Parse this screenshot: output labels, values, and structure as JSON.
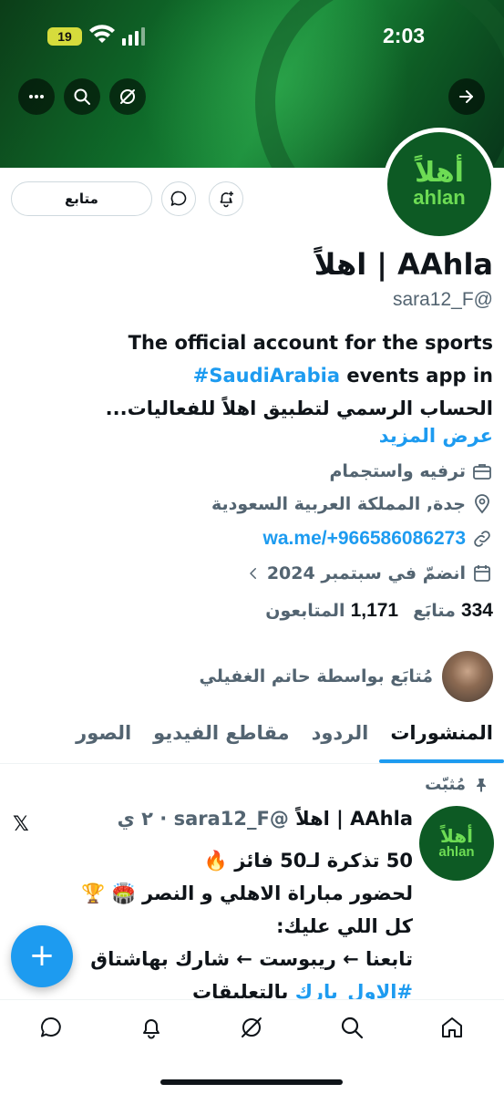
{
  "status_bar": {
    "time": "2:03",
    "battery": "19"
  },
  "colors": {
    "accent": "#1d9bf0",
    "banner": "#0f6b2a",
    "brand_green": "#6ddc54"
  },
  "header_buttons": [
    "more-icon",
    "search-icon",
    "grok-icon",
    "forward-arrow-icon"
  ],
  "avatar": {
    "glyph": "أهلاً",
    "word": "ahlan"
  },
  "actions": {
    "follow_label": "متابع"
  },
  "profile": {
    "display_name": "AAhla | اهلاً",
    "handle": "@sara12_F",
    "bio_line1": "The official account for the sports",
    "bio_hashtag": "#SaudiArabia",
    "bio_line2_rest": " events app in",
    "bio_line3": "الحساب الرسمي لتطبيق اهلاً للفعاليات...",
    "see_more": "عرض المزيد",
    "category": "ترفيه واستجمام",
    "location": "جدة, المملكة العربية السعودية",
    "link": "wa.me/+966586086273",
    "joined": "انضمّ في سبتمبر 2024"
  },
  "counts": {
    "following_count": "334",
    "following_label": "متابَع",
    "followers_count": "1,171",
    "followers_label": "المتابعون"
  },
  "followed_by": "مُتابَع بواسطة حاتم الغفيلي",
  "tabs": [
    "المنشورات",
    "الردود",
    "مقاطع الفيديو",
    "الصور"
  ],
  "pinned_post": {
    "pinned_label": "مُثبّت",
    "author": "AAhla | اهلاً",
    "handle": "@sara12_F",
    "time": "٢ ي",
    "line1": "50 تذكرة لـ50 فائز 🔥",
    "line2": "لحضور مباراة الاهلي و النصر 🏟️ 🏆",
    "line3": "كل اللي عليك:",
    "line4": "تابعنا ← ريبوست ← شارك بهاشتاق",
    "line5_tag": "#الاول_بارك",
    "line5_rest": " بالتعليقات"
  },
  "fab": {
    "label": "+"
  },
  "bottom_nav": [
    "messages-icon",
    "notifications-icon",
    "grok-icon",
    "search-icon",
    "home-icon"
  ]
}
